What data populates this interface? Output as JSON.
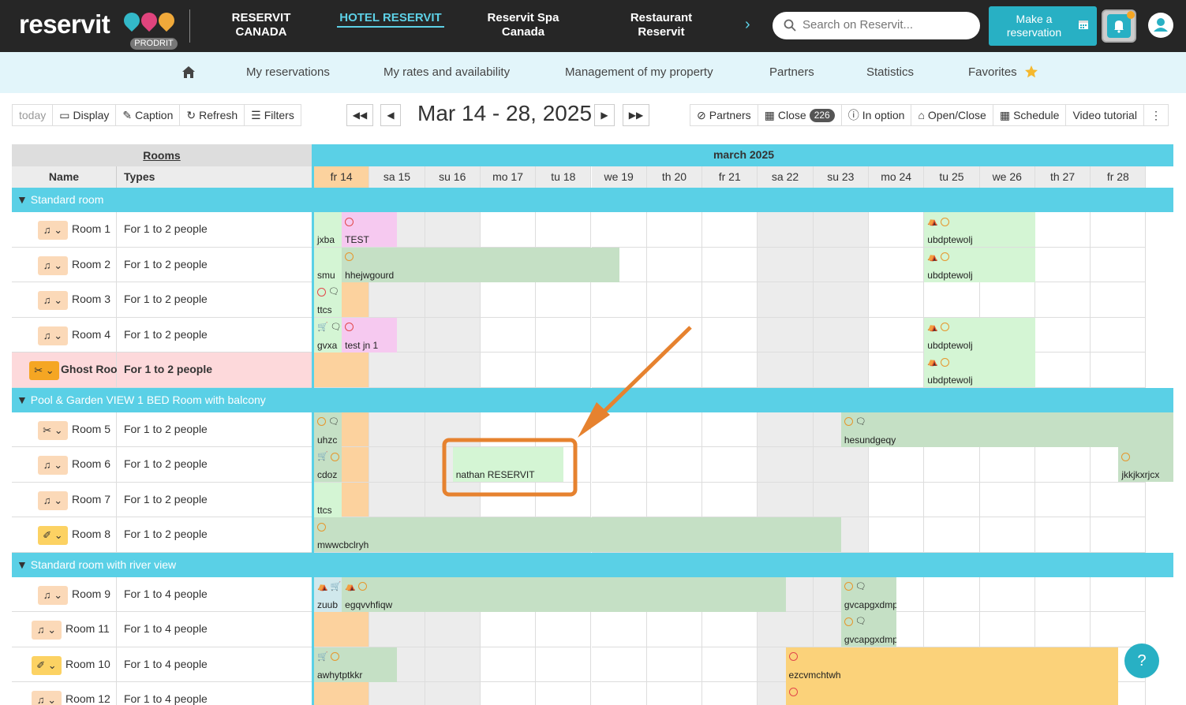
{
  "brand": {
    "logo": "reservit",
    "badge": "PRODRIT"
  },
  "property_tabs": [
    {
      "label": "RESERVIT CANADA",
      "active": false
    },
    {
      "label": "HOTEL RESERVIT",
      "active": true
    },
    {
      "label": "Reservit Spa Canada",
      "active": false
    },
    {
      "label": "Restaurant Reservit",
      "active": false
    }
  ],
  "search": {
    "placeholder": "Search on Reservit..."
  },
  "make_res": {
    "label": "Make a reservation"
  },
  "nav": {
    "items": [
      "My reservations",
      "My rates and availability",
      "Management of my property",
      "Partners",
      "Statistics",
      "Favorites"
    ]
  },
  "toolbar": {
    "left": [
      "today",
      "Display",
      "Caption",
      "Refresh",
      "Filters"
    ],
    "date_range": "Mar 14 - 28, 2025",
    "right": [
      "Partners",
      "Close",
      "In option",
      "Open/Close",
      "Schedule",
      "Video tutorial"
    ],
    "close_count": "226"
  },
  "grid": {
    "rooms_header": "Rooms",
    "name_header": "Name",
    "types_header": "Types",
    "month": "march 2025",
    "days": [
      "fr 14",
      "sa 15",
      "su 16",
      "mo 17",
      "tu 18",
      "we 19",
      "th 20",
      "fr 21",
      "sa 22",
      "su 23",
      "mo 24",
      "tu 25",
      "we 26",
      "th 27",
      "fr 28"
    ],
    "categories": [
      "Standard room",
      "Pool & Garden VIEW 1 BED Room with balcony",
      "Standard room with river view"
    ],
    "rooms": [
      {
        "name": "Room 1",
        "type": "For 1 to 2 people"
      },
      {
        "name": "Room 2",
        "type": "For 1 to 2 people"
      },
      {
        "name": "Room 3",
        "type": "For 1 to 2 people"
      },
      {
        "name": "Room 4",
        "type": "For 1 to 2 people"
      },
      {
        "name": "Ghost Room",
        "type": "For 1 to 2 people"
      },
      {
        "name": "Room 5",
        "type": "For 1 to 2 people"
      },
      {
        "name": "Room 6",
        "type": "For 1 to 2 people"
      },
      {
        "name": "Room 7",
        "type": "For 1 to 2 people"
      },
      {
        "name": "Room 8",
        "type": "For 1 to 2 people"
      },
      {
        "name": "Room 9",
        "type": "For 1 to 4 people"
      },
      {
        "name": "Room 11",
        "type": "For 1 to 4 people"
      },
      {
        "name": "Room 10",
        "type": "For 1 to 4 people"
      },
      {
        "name": "Room 12",
        "type": "For 1 to 4 people"
      }
    ],
    "reservations": [
      {
        "row": 0,
        "text": "jxba",
        "color": "#d4f5d4"
      },
      {
        "row": 0,
        "text": "TEST",
        "color": "#f6c9f0",
        "icons": "circle-red"
      },
      {
        "row": 0,
        "text": "ubdptewolj",
        "color": "#d4f5d4",
        "icons": "tent circle"
      },
      {
        "row": 1,
        "text": "smu",
        "color": "#d4f5d4"
      },
      {
        "row": 1,
        "text": "hhejwgourd",
        "color": "#c5e0c5",
        "icons": "circle"
      },
      {
        "row": 1,
        "text": "ubdptewolj",
        "color": "#d4f5d4",
        "icons": "tent circle"
      },
      {
        "row": 2,
        "text": "ttcs",
        "color": "#d4f5d4",
        "icons": "circle-red bubble"
      },
      {
        "row": 3,
        "text": "gvxa",
        "color": "#d4f5d4",
        "icons": "cart bubble"
      },
      {
        "row": 3,
        "text": "test jn 1",
        "color": "#f6c9f0",
        "icons": "circle-red"
      },
      {
        "row": 3,
        "text": "ubdptewolj",
        "color": "#d4f5d4",
        "icons": "tent circle"
      },
      {
        "row": 4,
        "text": "ubdptewolj",
        "color": "#d4f5d4",
        "icons": "tent circle"
      },
      {
        "row": 5,
        "text": "uhzc",
        "color": "#c5e0c5",
        "icons": "circle bubble"
      },
      {
        "row": 5,
        "text": "hesundgeqy",
        "color": "#c5e0c5",
        "icons": "circle bubble"
      },
      {
        "row": 6,
        "text": "cdoz",
        "color": "#c5e0c5",
        "icons": "cart circle"
      },
      {
        "row": 6,
        "text": "nathan RESERVIT",
        "color": "#d4f5d4"
      },
      {
        "row": 6,
        "text": "jkkjkxrjcx",
        "color": "#c5e0c5",
        "icons": "circle"
      },
      {
        "row": 7,
        "text": "ttcs",
        "color": "#d4f5d4"
      },
      {
        "row": 8,
        "text": "mwwcbclryh",
        "color": "#c5e0c5",
        "icons": "circle"
      },
      {
        "row": 9,
        "text": "zuub",
        "color": "#d0e8ec",
        "icons": "tent cart"
      },
      {
        "row": 9,
        "text": "egqvvhfiqw",
        "color": "#c5e0c5",
        "icons": "tent circle"
      },
      {
        "row": 9,
        "text": "gvcapgxdmp",
        "color": "#c5e0c5",
        "icons": "circle bubble"
      },
      {
        "row": 10,
        "text": "gvcapgxdmp",
        "color": "#c5e0c5",
        "icons": "circle bubble"
      },
      {
        "row": 11,
        "text": "awhytptkkr",
        "color": "#c5e0c5",
        "icons": "cart circle"
      },
      {
        "row": 11,
        "text": "ezcvmchtwh",
        "color": "#fbd27a",
        "icons": "circle-red"
      },
      {
        "row": 12,
        "text": "",
        "color": "#fbd27a",
        "icons": "circle-red"
      }
    ]
  },
  "colors": {
    "accent": "#28b0c4",
    "category": "#5ad0e6",
    "today": "#fcd29e",
    "weekend": "#ececec",
    "ghost": "#fdd9db",
    "callout": "#e6822f"
  }
}
